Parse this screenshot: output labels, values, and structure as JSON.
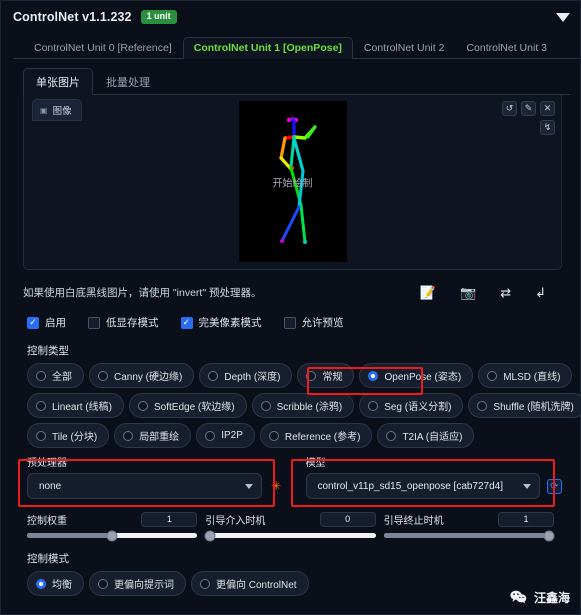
{
  "header": {
    "title": "ControlNet v1.1.232",
    "badge": "1 unit",
    "collapse_icon": "chevron-down-icon"
  },
  "unit_tabs": [
    {
      "label": "ControlNet Unit 0 [Reference]",
      "active": false
    },
    {
      "label": "ControlNet Unit 1 [OpenPose]",
      "active": true
    },
    {
      "label": "ControlNet Unit 2",
      "active": false
    },
    {
      "label": "ControlNet Unit 3",
      "active": false
    }
  ],
  "sub_tabs": [
    {
      "label": "单张图片",
      "active": true
    },
    {
      "label": "批量处理",
      "active": false
    }
  ],
  "image_panel": {
    "tab_label": "图像",
    "tab_icon": "image-icon",
    "canvas_label": "开始绘制",
    "tools": [
      {
        "icon": "undo-icon",
        "glyph": "↺"
      },
      {
        "icon": "edit-icon",
        "glyph": "✎"
      },
      {
        "icon": "close-icon",
        "glyph": "✕"
      },
      {
        "icon": "redo-icon",
        "glyph": "↯"
      }
    ]
  },
  "hint": {
    "text": "如果使用白底黑线图片，请使用 \"invert\" 预处理器。",
    "icons": [
      {
        "name": "edit-note-icon",
        "glyph": "📝"
      },
      {
        "name": "camera-icon",
        "glyph": "📷"
      },
      {
        "name": "swap-icon",
        "glyph": "⇄"
      },
      {
        "name": "send-icon",
        "glyph": "↲"
      }
    ]
  },
  "checkboxes": [
    {
      "label": "启用",
      "checked": true
    },
    {
      "label": "低显存模式",
      "checked": false
    },
    {
      "label": "完美像素模式",
      "checked": true
    },
    {
      "label": "允许预览",
      "checked": false
    }
  ],
  "control_type": {
    "label": "控制类型",
    "rows": [
      [
        {
          "label": "全部",
          "selected": false
        },
        {
          "label": "Canny (硬边缘)",
          "selected": false
        },
        {
          "label": "Depth (深度)",
          "selected": false
        },
        {
          "label": "常规",
          "selected": false
        },
        {
          "label": "OpenPose (姿态)",
          "selected": true
        },
        {
          "label": "MLSD (直线)",
          "selected": false
        }
      ],
      [
        {
          "label": "Lineart (线稿)",
          "selected": false
        },
        {
          "label": "SoftEdge (软边缘)",
          "selected": false
        },
        {
          "label": "Scribble (涂鸦)",
          "selected": false
        },
        {
          "label": "Seg (语义分割)",
          "selected": false
        },
        {
          "label": "Shuffle (随机洗牌)",
          "selected": false
        }
      ],
      [
        {
          "label": "Tile (分块)",
          "selected": false
        },
        {
          "label": "局部重绘",
          "selected": false
        },
        {
          "label": "IP2P",
          "selected": false
        },
        {
          "label": "Reference (参考)",
          "selected": false
        },
        {
          "label": "T2IA (自适应)",
          "selected": false
        }
      ]
    ]
  },
  "preprocessor": {
    "label": "预处理器",
    "value": "none",
    "action_icon": "explosion-icon",
    "action_glyph": "✳"
  },
  "model": {
    "label": "模型",
    "value": "control_v11p_sd15_openpose [cab727d4]",
    "action_icon": "refresh-icon",
    "action_glyph": "⟳"
  },
  "sliders": [
    {
      "label": "控制权重",
      "value": "1",
      "percent": 50
    },
    {
      "label": "引导介入时机",
      "value": "0",
      "percent": 0
    },
    {
      "label": "引导终止时机",
      "value": "1",
      "percent": 100
    }
  ],
  "control_mode": {
    "label": "控制模式",
    "options": [
      {
        "label": "均衡",
        "selected": true
      },
      {
        "label": "更偏向提示词",
        "selected": false
      },
      {
        "label": "更偏向 ControlNet",
        "selected": false
      }
    ]
  },
  "watermark": {
    "icon": "wechat-icon",
    "text": "汪鑫海"
  },
  "colors": {
    "accent_green": "#69e03a",
    "badge_green": "#2a8f3f",
    "accent_blue": "#2a6df5",
    "highlight_red": "#f01a1a",
    "orange": "#ff7a00"
  }
}
